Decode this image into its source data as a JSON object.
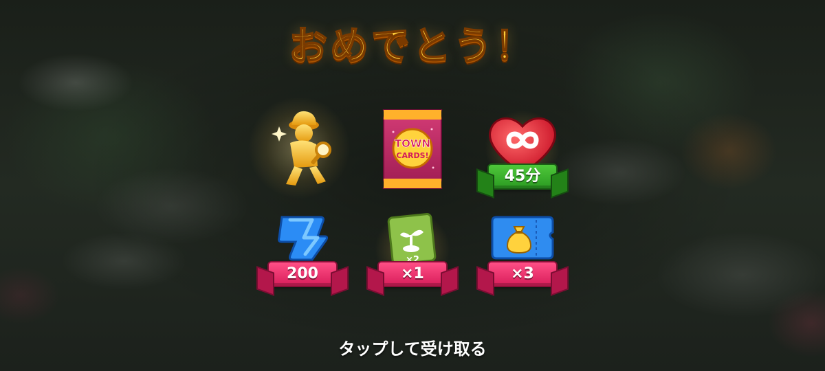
{
  "title": "おめでとう！",
  "rewards": [
    {
      "name": "golden-detective-trophy",
      "label": ""
    },
    {
      "name": "town-cards-pack",
      "label": "",
      "pack_text_1": "TOWN",
      "pack_text_2": "CARDS!"
    },
    {
      "name": "unlimited-lives",
      "label": "45分"
    },
    {
      "name": "energy-bolts",
      "label": "200"
    },
    {
      "name": "seed-card",
      "label": "×1",
      "card_multiplier": "×2"
    },
    {
      "name": "coin-bag-ticket",
      "label": "×3"
    }
  ],
  "hint": "タップして受け取る",
  "colors": {
    "title": "#ffcf3a",
    "ribbon_pink": "#e32a65",
    "ribbon_green": "#35ad2a"
  }
}
